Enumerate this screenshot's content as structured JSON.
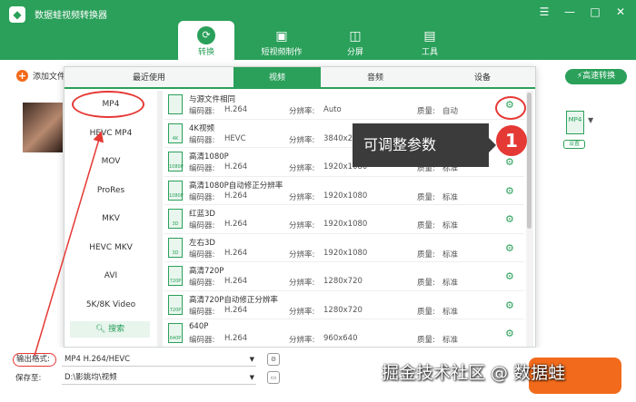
{
  "app": {
    "title": "数据蛙视频转换器",
    "logo_icon": "app-logo-icon"
  },
  "window_controls": [
    "menu-icon",
    "minimize-icon",
    "maximize-icon",
    "close-icon"
  ],
  "main_tabs": [
    {
      "label": "转换",
      "icon": "convert-icon",
      "active": true
    },
    {
      "label": "短视频制作",
      "icon": "image-icon",
      "active": false
    },
    {
      "label": "分屏",
      "icon": "split-screen-icon",
      "active": false
    },
    {
      "label": "工具",
      "icon": "toolbox-icon",
      "active": false
    }
  ],
  "toolbar": {
    "add_file": "添加文件",
    "fast_convert": "高速转换"
  },
  "file_item": {
    "format_badge": "MP4",
    "settings": "设置"
  },
  "popup": {
    "tabs": [
      {
        "label": "最近使用",
        "active": false
      },
      {
        "label": "视频",
        "active": true
      },
      {
        "label": "音频",
        "active": false
      },
      {
        "label": "设备",
        "active": false
      }
    ],
    "formats": [
      "MP4",
      "HEVC MP4",
      "MOV",
      "ProRes",
      "MKV",
      "HEVC MKV",
      "AVI",
      "5K/8K Video"
    ],
    "search": "搜索",
    "labels": {
      "encoder": "编码器:",
      "resolution": "分辨率:",
      "quality": "质量:"
    },
    "options": [
      {
        "name": "与源文件相同",
        "encoder": "H.264",
        "resolution": "Auto",
        "quality": "自动",
        "badge": ""
      },
      {
        "name": "4K视频",
        "encoder": "HEVC",
        "resolution": "3840x2160",
        "quality": "",
        "badge": "4K"
      },
      {
        "name": "高清1080P",
        "encoder": "H.264",
        "resolution": "1920x1080",
        "quality": "标准",
        "badge": "1080P"
      },
      {
        "name": "高清1080P自动修正分辨率",
        "encoder": "H.264",
        "resolution": "1920x1080",
        "quality": "标准",
        "badge": "1080P"
      },
      {
        "name": "红蓝3D",
        "encoder": "H.264",
        "resolution": "1920x1080",
        "quality": "标准",
        "badge": "3D"
      },
      {
        "name": "左右3D",
        "encoder": "H.264",
        "resolution": "1920x1080",
        "quality": "标准",
        "badge": "3D"
      },
      {
        "name": "高清720P",
        "encoder": "H.264",
        "resolution": "1280x720",
        "quality": "标准",
        "badge": "720P"
      },
      {
        "name": "高清720P自动修正分辨率",
        "encoder": "H.264",
        "resolution": "1280x720",
        "quality": "标准",
        "badge": "720P"
      },
      {
        "name": "640P",
        "encoder": "H.264",
        "resolution": "960x640",
        "quality": "标准",
        "badge": "640P"
      }
    ]
  },
  "annotation": {
    "callout": "可调整参数",
    "badge": "1",
    "highlight_color": "#e53935"
  },
  "bottom": {
    "output_label": "输出格式:",
    "output_value": "MP4 H.264/HEVC",
    "save_label": "保存至:",
    "save_value": "D:\\影姚均\\视频"
  },
  "watermark": "掘金技术社区 @ 数据蛙",
  "colors": {
    "brand_green": "#2aa05a",
    "accent_orange": "#f26a1b",
    "annotation_red": "#e53935"
  }
}
